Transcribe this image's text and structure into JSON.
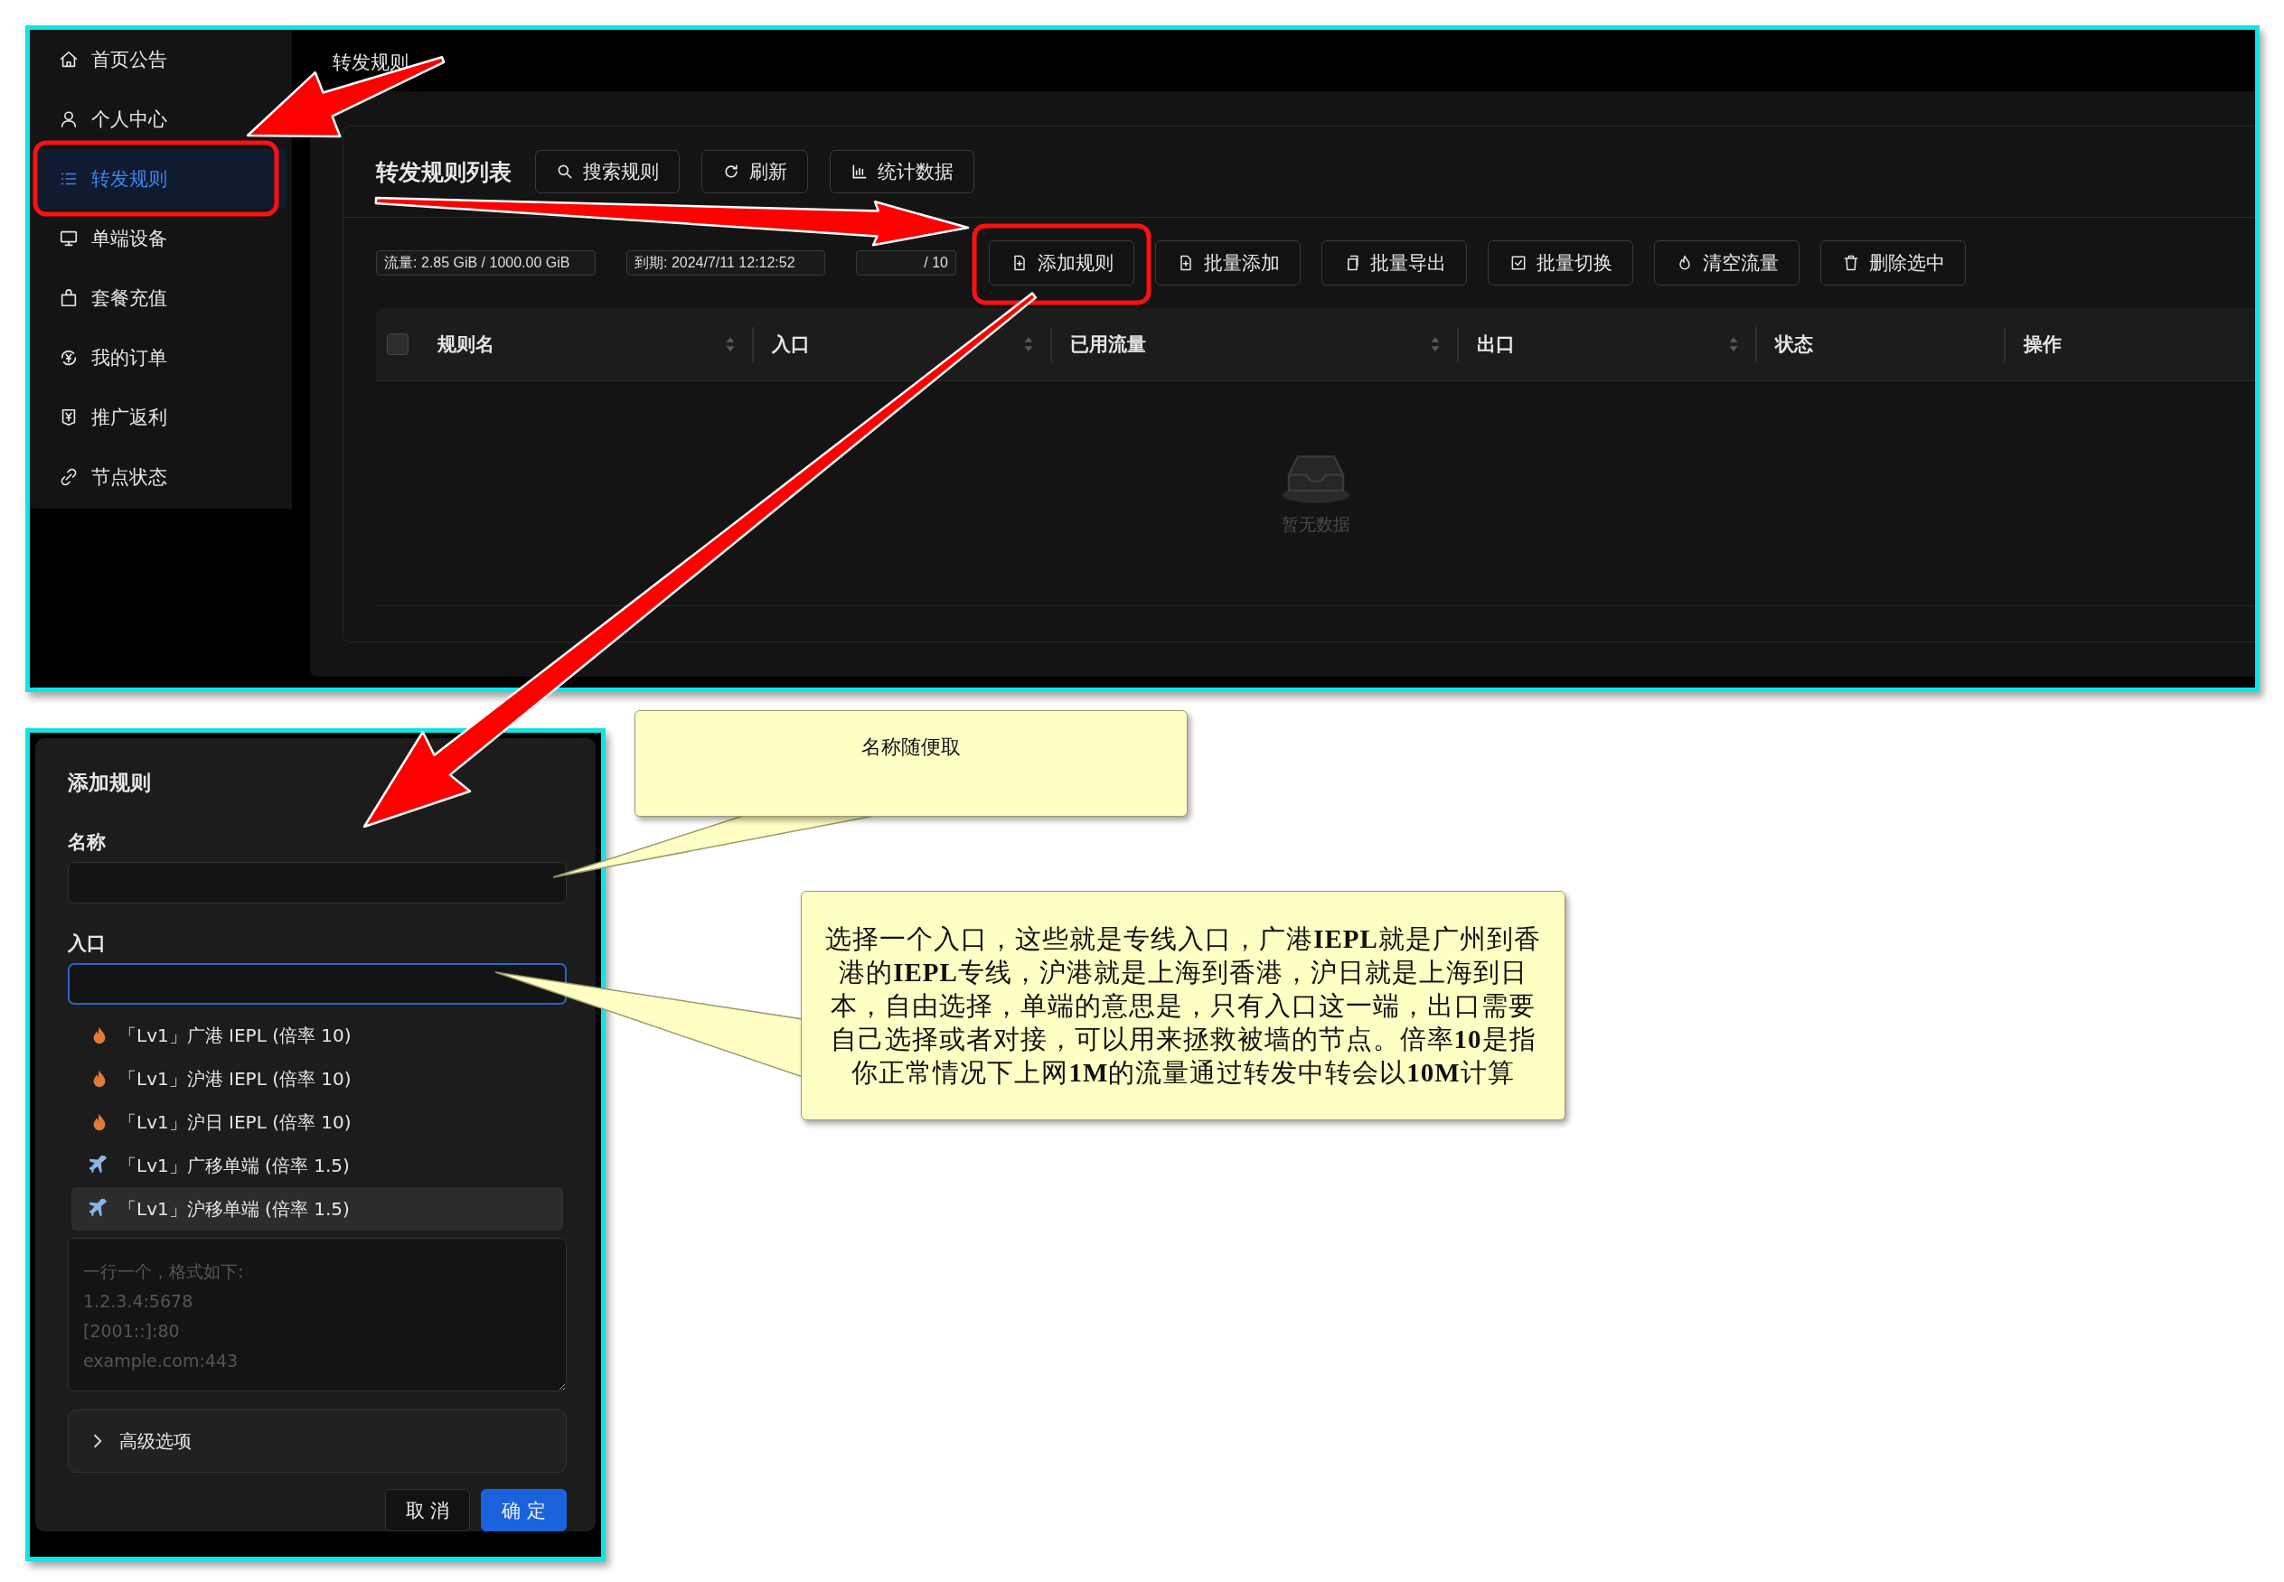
{
  "sidebar": {
    "items": [
      {
        "label": "首页公告",
        "selected": false
      },
      {
        "label": "个人中心",
        "selected": false
      },
      {
        "label": "转发规则",
        "selected": true
      },
      {
        "label": "单端设备",
        "selected": false
      },
      {
        "label": "套餐充值",
        "selected": false
      },
      {
        "label": "我的订单",
        "selected": false
      },
      {
        "label": "推广返利",
        "selected": false
      },
      {
        "label": "节点状态",
        "selected": false
      }
    ]
  },
  "header": {
    "title": "转发规则"
  },
  "rules_panel": {
    "title": "转发规则列表",
    "actions": [
      "搜索规则",
      "刷新",
      "统计数据"
    ],
    "badges": [
      "流量: 2.85 GiB / 1000.00 GiB",
      "到期: 2024/7/11 12:12:52",
      "/ 10"
    ],
    "toolbar": [
      "添加规则",
      "批量添加",
      "批量导出",
      "批量切换",
      "清空流量",
      "删除选中"
    ],
    "table": {
      "select_all_checked": false,
      "columns": [
        {
          "label": "规则名",
          "sortable": true
        },
        {
          "label": "入口",
          "sortable": true
        },
        {
          "label": "已用流量",
          "sortable": true
        },
        {
          "label": "出口",
          "sortable": true
        },
        {
          "label": "状态",
          "sortable": false
        },
        {
          "label": "操作",
          "sortable": false
        }
      ],
      "empty_text": "暂无数据"
    }
  },
  "dialog": {
    "title": "添加规则",
    "name_label": "名称",
    "entry_label": "入口",
    "entry_focused": true,
    "entry_options": [
      {
        "kind": "fire",
        "label": "「Lv1」广港 IEPL (倍率 10)",
        "highlighted": false
      },
      {
        "kind": "fire",
        "label": "「Lv1」沪港 IEPL (倍率 10)",
        "highlighted": false
      },
      {
        "kind": "fire",
        "label": "「Lv1」沪日 IEPL (倍率 10)",
        "highlighted": false
      },
      {
        "kind": "plane",
        "label": "「Lv1」广移单端 (倍率 1.5)",
        "highlighted": false
      },
      {
        "kind": "plane",
        "label": "「Lv1」沪移单端 (倍率 1.5)",
        "highlighted": true
      }
    ],
    "targets_placeholder": "一行一个，格式如下:\n1.2.3.4:5678\n[2001::]:80\nexample.com:443",
    "advanced": {
      "label": "高级选项",
      "expanded": false
    },
    "buttons": [
      {
        "label": "取 消",
        "primary": false
      },
      {
        "label": "确 定",
        "primary": true
      }
    ]
  },
  "callouts": [
    {
      "text": "名称随便取"
    },
    {
      "text": "选择一个入口，这些就是专线入口，广港**IEPL**就是广州到香港的**IEPL**专线，沪港就是上海到香港，沪日就是上海到日本，自由选择，单端的意思是，只有入口这一端，出口需要自己选择或者对接，可以用来拯救被墙的节点。倍率**10**是指你正常情况下上网**1M**的流量通过转发中转会以**10M**计算"
    }
  ]
}
